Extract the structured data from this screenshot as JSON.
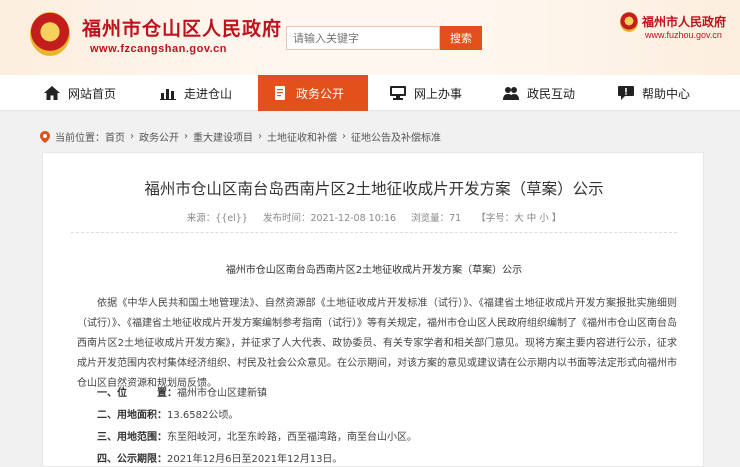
{
  "header": {
    "site_name": "福州市仓山区人民政府",
    "site_url": "www.fzcangshan.gov.cn",
    "search_placeholder": "请输入关键字",
    "search_button": "搜索",
    "city_site_name": "福州市人民政府",
    "city_site_url": "www.fuzhou.gov.cn"
  },
  "nav": {
    "items": [
      {
        "label": "网站首页",
        "icon": "home-icon"
      },
      {
        "label": "走进仓山",
        "icon": "chart-icon"
      },
      {
        "label": "政务公开",
        "icon": "document-icon",
        "active": true
      },
      {
        "label": "网上办事",
        "icon": "monitor-icon"
      },
      {
        "label": "政民互动",
        "icon": "people-icon"
      },
      {
        "label": "帮助中心",
        "icon": "chat-icon"
      }
    ],
    "active_color": "#e2501c"
  },
  "breadcrumb": {
    "prefix": "当前位置：",
    "items": [
      "首页",
      "政务公开",
      "重大建设项目",
      "土地征收和补偿",
      "征地公告及补偿标准"
    ],
    "separator": "›"
  },
  "article": {
    "title": "福州市仓山区南台岛西南片区2土地征收成片开发方案（草案）公示",
    "meta": {
      "source": "来源：{{el}}",
      "published": "发布时间：2021-12-08 10:16",
      "views": "浏览量：71",
      "font_size": "【字号：大 中 小 】"
    },
    "subtitle": "福州市仓山区南台岛西南片区2土地征收成片开发方案（草案）公示",
    "paragraph": "依据《中华人民共和国土地管理法》、自然资源部《土地征收成片开发标准（试行）》、《福建省土地征收成片开发方案报批实施细则（试行）》、《福建省土地征收成片开发方案编制参考指南（试行）》等有关规定，福州市仓山区人民政府组织编制了《福州市仓山区南台岛西南片区2土地征收成片开发方案》，并征求了人大代表、政协委员、有关专家学者和相关部门意见。现将方案主要内容进行公示，征求成片开发范围内农村集体经济组织、村民及社会公众意见。在公示期间，对该方案的意见或建议请在公示期内以书面等法定形式向福州市仓山区自然资源和规划局反馈。",
    "items": [
      {
        "label": "一、位　　　置：",
        "value": "福州市仓山区建新镇"
      },
      {
        "label": "二、用地面积：",
        "value": "13.6582公顷。"
      },
      {
        "label": "三、用地范围：",
        "value": "东至阳岐河，北至东岭路，西至福湾路，南至台山小区。"
      },
      {
        "label": "四、公示期限：",
        "value": "2021年12月6日至2021年12月13日。"
      }
    ]
  }
}
